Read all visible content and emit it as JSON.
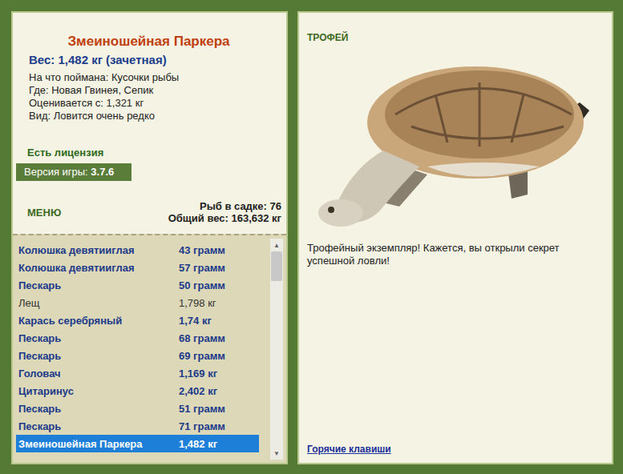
{
  "catch": {
    "title": "Змеиношейная Паркера",
    "weight": "Вес: 1,482 кг (зачетная)",
    "details": [
      "На что поймана: Кусочки рыбы",
      "Где: Новая Гвинея, Сепик",
      "Оценивается с: 1,321 кг",
      "Вид: Ловится очень редко"
    ]
  },
  "license": "Есть лицензия",
  "version": {
    "label": "Версия игры: ",
    "value": "3.7.6"
  },
  "menu": "МЕНЮ",
  "keepnet": {
    "count": "Рыб в садке: 76",
    "total": "Общий вес: 163,632 кг"
  },
  "rows": [
    {
      "name": "Колюшка девятииглая",
      "weight": "43 грамм",
      "bold": true,
      "selected": false
    },
    {
      "name": "Колюшка девятииглая",
      "weight": "57 грамм",
      "bold": true,
      "selected": false
    },
    {
      "name": "Пескарь",
      "weight": "50 грамм",
      "bold": true,
      "selected": false
    },
    {
      "name": "Лещ",
      "weight": "1,798 кг",
      "bold": false,
      "selected": false
    },
    {
      "name": "Карась серебряный",
      "weight": "1,74 кг",
      "bold": true,
      "selected": false
    },
    {
      "name": "Пескарь",
      "weight": "68 грамм",
      "bold": true,
      "selected": false
    },
    {
      "name": "Пескарь",
      "weight": "69 грамм",
      "bold": true,
      "selected": false
    },
    {
      "name": "Головач",
      "weight": "1,169 кг",
      "bold": true,
      "selected": false
    },
    {
      "name": "Цитаринус",
      "weight": "2,402 кг",
      "bold": true,
      "selected": false
    },
    {
      "name": "Пескарь",
      "weight": "51 грамм",
      "bold": true,
      "selected": false
    },
    {
      "name": "Пескарь",
      "weight": "71 грамм",
      "bold": true,
      "selected": false
    },
    {
      "name": "Змеиношейная Паркера",
      "weight": "1,482 кг",
      "bold": true,
      "selected": true
    }
  ],
  "scrollbar": {
    "level": 1,
    "up": "▲",
    "down": "▼"
  },
  "trophy": {
    "label": "ТРОФЕЙ",
    "message": "Трофейный экземпляр! Кажется, вы открыли секрет успешной ловли!"
  },
  "hotkeys": "Горячие клавиши"
}
